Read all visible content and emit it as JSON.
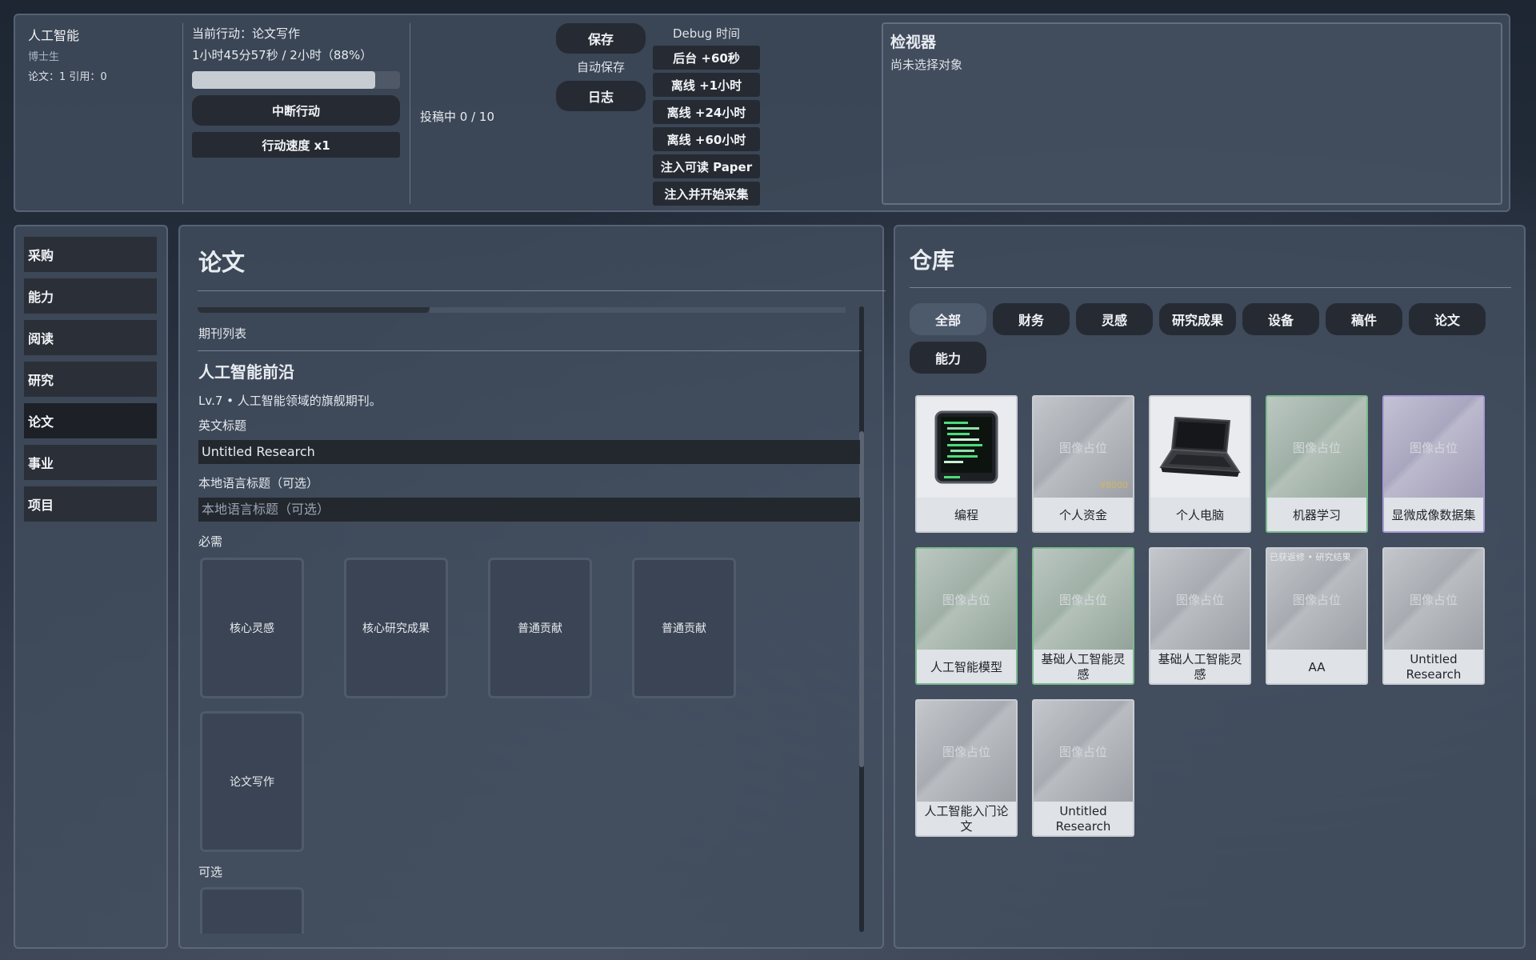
{
  "profile": {
    "name": "人工智能",
    "title": "博士生",
    "stats": "论文：1  引用：0"
  },
  "action": {
    "current": "当前行动：论文写作",
    "time": "1小时45分57秒 / 2小时（88%）",
    "progress": 0.88,
    "interrupt_label": "中断行动",
    "speed_label": "行动速度 x1"
  },
  "submission": "投稿中 0 / 10",
  "save": {
    "save_label": "保存",
    "autosave_label": "自动保存",
    "log_label": "日志"
  },
  "debug": {
    "title": "Debug 时间",
    "buttons": [
      "后台 +60秒",
      "离线 +1小时",
      "离线 +24小时",
      "离线 +60小时",
      "注入可读 Paper",
      "注入并开始采集"
    ]
  },
  "inspector": {
    "title": "检视器",
    "empty_text": "尚未选择对象"
  },
  "sidebar": {
    "items": [
      {
        "label": "采购"
      },
      {
        "label": "能力"
      },
      {
        "label": "阅读"
      },
      {
        "label": "研究"
      },
      {
        "label": "论文"
      },
      {
        "label": "事业"
      },
      {
        "label": "项目"
      }
    ],
    "active": "论文"
  },
  "paper": {
    "title": "论文",
    "journal_list_label": "期刊列表",
    "journal_name": "人工智能前沿",
    "journal_desc": "Lv.7 • 人工智能领域的旗舰期刊。",
    "en_title_label": "英文标题",
    "en_title_value": "Untitled Research",
    "local_title_label": "本地语言标题（可选）",
    "local_title_placeholder": "本地语言标题（可选）",
    "required_label": "必需",
    "required_slots": [
      "核心灵感",
      "核心研究成果",
      "普通贡献",
      "普通贡献",
      "论文写作"
    ],
    "optional_label": "可选"
  },
  "warehouse": {
    "title": "仓库",
    "tabs": [
      "全部",
      "财务",
      "灵感",
      "研究成果",
      "设备",
      "稿件",
      "论文",
      "能力"
    ],
    "active_tab": "全部",
    "placeholder_text": "图像占位",
    "cards": [
      {
        "label": "编程",
        "image": "code-terminal-icon"
      },
      {
        "label": "个人资金",
        "price": "¥8000"
      },
      {
        "label": "个人电脑",
        "image": "laptop-icon"
      },
      {
        "label": "机器学习",
        "border": "green"
      },
      {
        "label": "显微成像数据集",
        "border": "purple"
      },
      {
        "label": "人工智能模型",
        "border": "green"
      },
      {
        "label": "基础人工智能灵感",
        "border": "green"
      },
      {
        "label": "基础人工智能灵感"
      },
      {
        "label": "AA",
        "tag": "已获返修 • 研究结果"
      },
      {
        "label": "Untitled Research"
      },
      {
        "label": "人工智能入门论文"
      },
      {
        "label": "Untitled Research"
      }
    ]
  },
  "colors": {
    "panel": "#424e5f",
    "button": "#262b33",
    "active_tab": "#4d5a6c",
    "green_border": "#7dba8c",
    "purple_border": "#a89ad6"
  }
}
